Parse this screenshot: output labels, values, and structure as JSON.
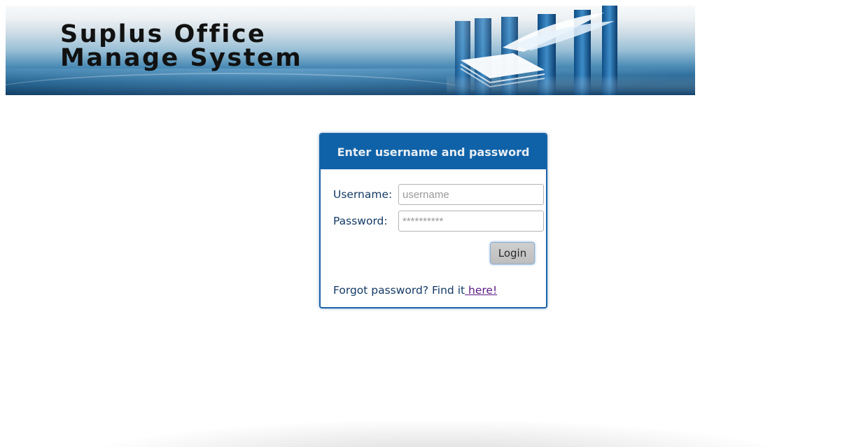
{
  "banner": {
    "title_line1": "Suplus Office",
    "title_line2": "Manage System"
  },
  "login": {
    "header": "Enter username and password",
    "username_label": "Username:",
    "username_placeholder": "username",
    "password_label": "Password:",
    "password_placeholder": "**********",
    "login_button": "Login",
    "forgot_text": "Forgot password? Find it",
    "forgot_link": " here!"
  },
  "colors": {
    "header_bg": "#0f62a8",
    "panel_border": "#1a62a6",
    "label_text": "#143a66",
    "link_visited": "#5b1a82"
  },
  "icons": {
    "banner_art": "buildings-and-papers-icon"
  }
}
